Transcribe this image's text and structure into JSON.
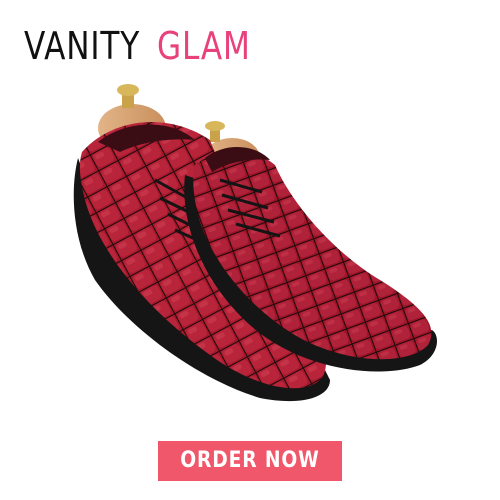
{
  "brand": {
    "name_part1": "VANITY",
    "name_part2": "GLAM"
  },
  "product": {
    "image_icon": "red-croc-leather-oxford-shoes"
  },
  "cta": {
    "label": "ORDER NOW"
  },
  "colors": {
    "brand_accent": "#e8417c",
    "button_bg": "#f0576a",
    "shoe_leather": "#a5192d"
  }
}
